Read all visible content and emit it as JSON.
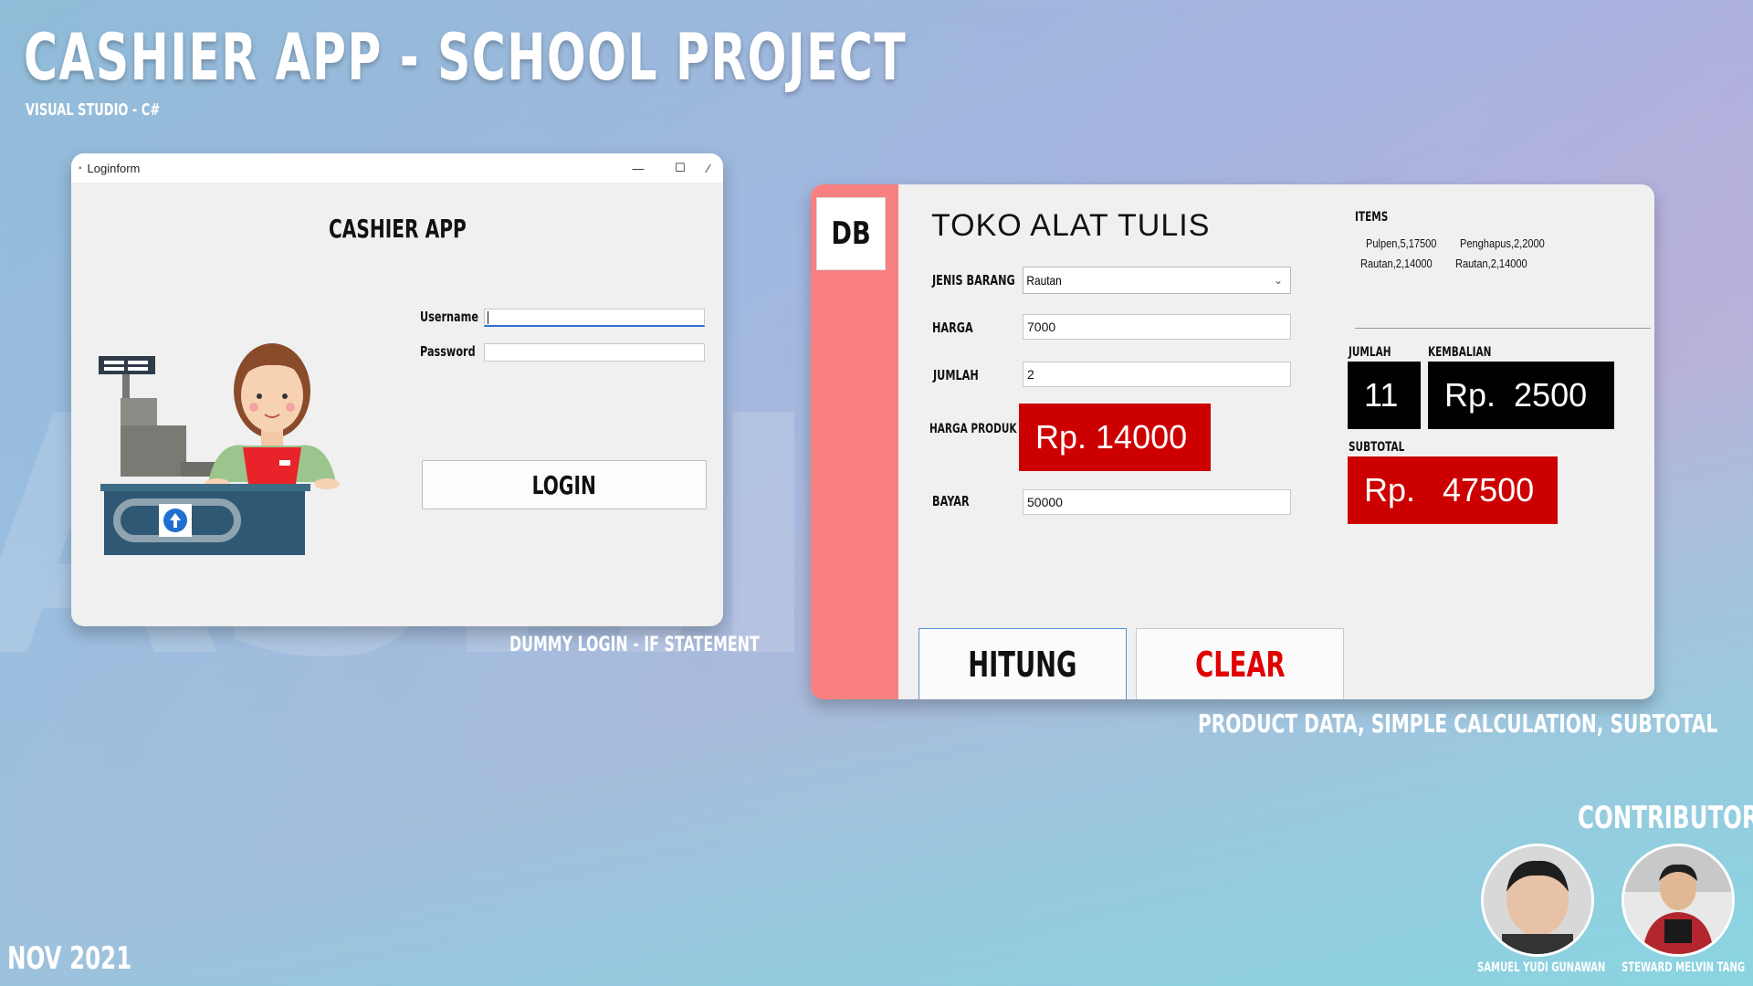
{
  "header": {
    "title": "CASHIER APP - SCHOOL PROJECT",
    "subtitle": "VISUAL STUDIO - C#"
  },
  "login_window": {
    "title": "Loginform",
    "minimize": "—",
    "maximize": "☐",
    "heading": "CASHIER APP",
    "username_label": "Username",
    "password_label": "Password",
    "username_value": "",
    "password_value": "",
    "login_label": "LOGIN"
  },
  "login_caption": "DUMMY LOGIN - IF STATEMENT",
  "cashier_window": {
    "db_label": "DB",
    "shop_title": "TOKO ALAT TULIS",
    "jenis_barang_label": "JENIS BARANG",
    "jenis_barang_value": "Rautan",
    "harga_label": "HARGA",
    "harga_value": "7000",
    "jumlah_label": "JUMLAH",
    "jumlah_value": "2",
    "harga_produk_label": "HARGA PRODUK",
    "harga_produk_value": "Rp. 14000",
    "bayar_label": "BAYAR",
    "bayar_value": "50000",
    "items_label": "ITEMS",
    "items": [
      "Pulpen,5,17500",
      "Penghapus,2,2000",
      "Rautan,2,14000",
      "Rautan,2,14000"
    ],
    "total_jumlah_label": "JUMLAH",
    "total_jumlah_value": "11",
    "kembalian_label": "KEMBALIAN",
    "kembalian_value": "Rp.  2500",
    "subtotal_label": "SUBTOTAL",
    "subtotal_value": "Rp.   47500",
    "hitung_label": "HITUNG",
    "clear_label": "CLEAR"
  },
  "cashier_caption": "PRODUCT DATA, SIMPLE CALCULATION, SUBTOTAL",
  "contributors": {
    "heading": "CONTRIBUTORS",
    "people": [
      {
        "name": "SAMUEL YUDI GUNAWAN"
      },
      {
        "name": "STEWARD MELVIN TANG"
      }
    ]
  },
  "date": "NOV 2021",
  "colors": {
    "accent_red": "#cc0000",
    "sidebar_pink": "#f88080",
    "clear_text": "#e00000"
  }
}
